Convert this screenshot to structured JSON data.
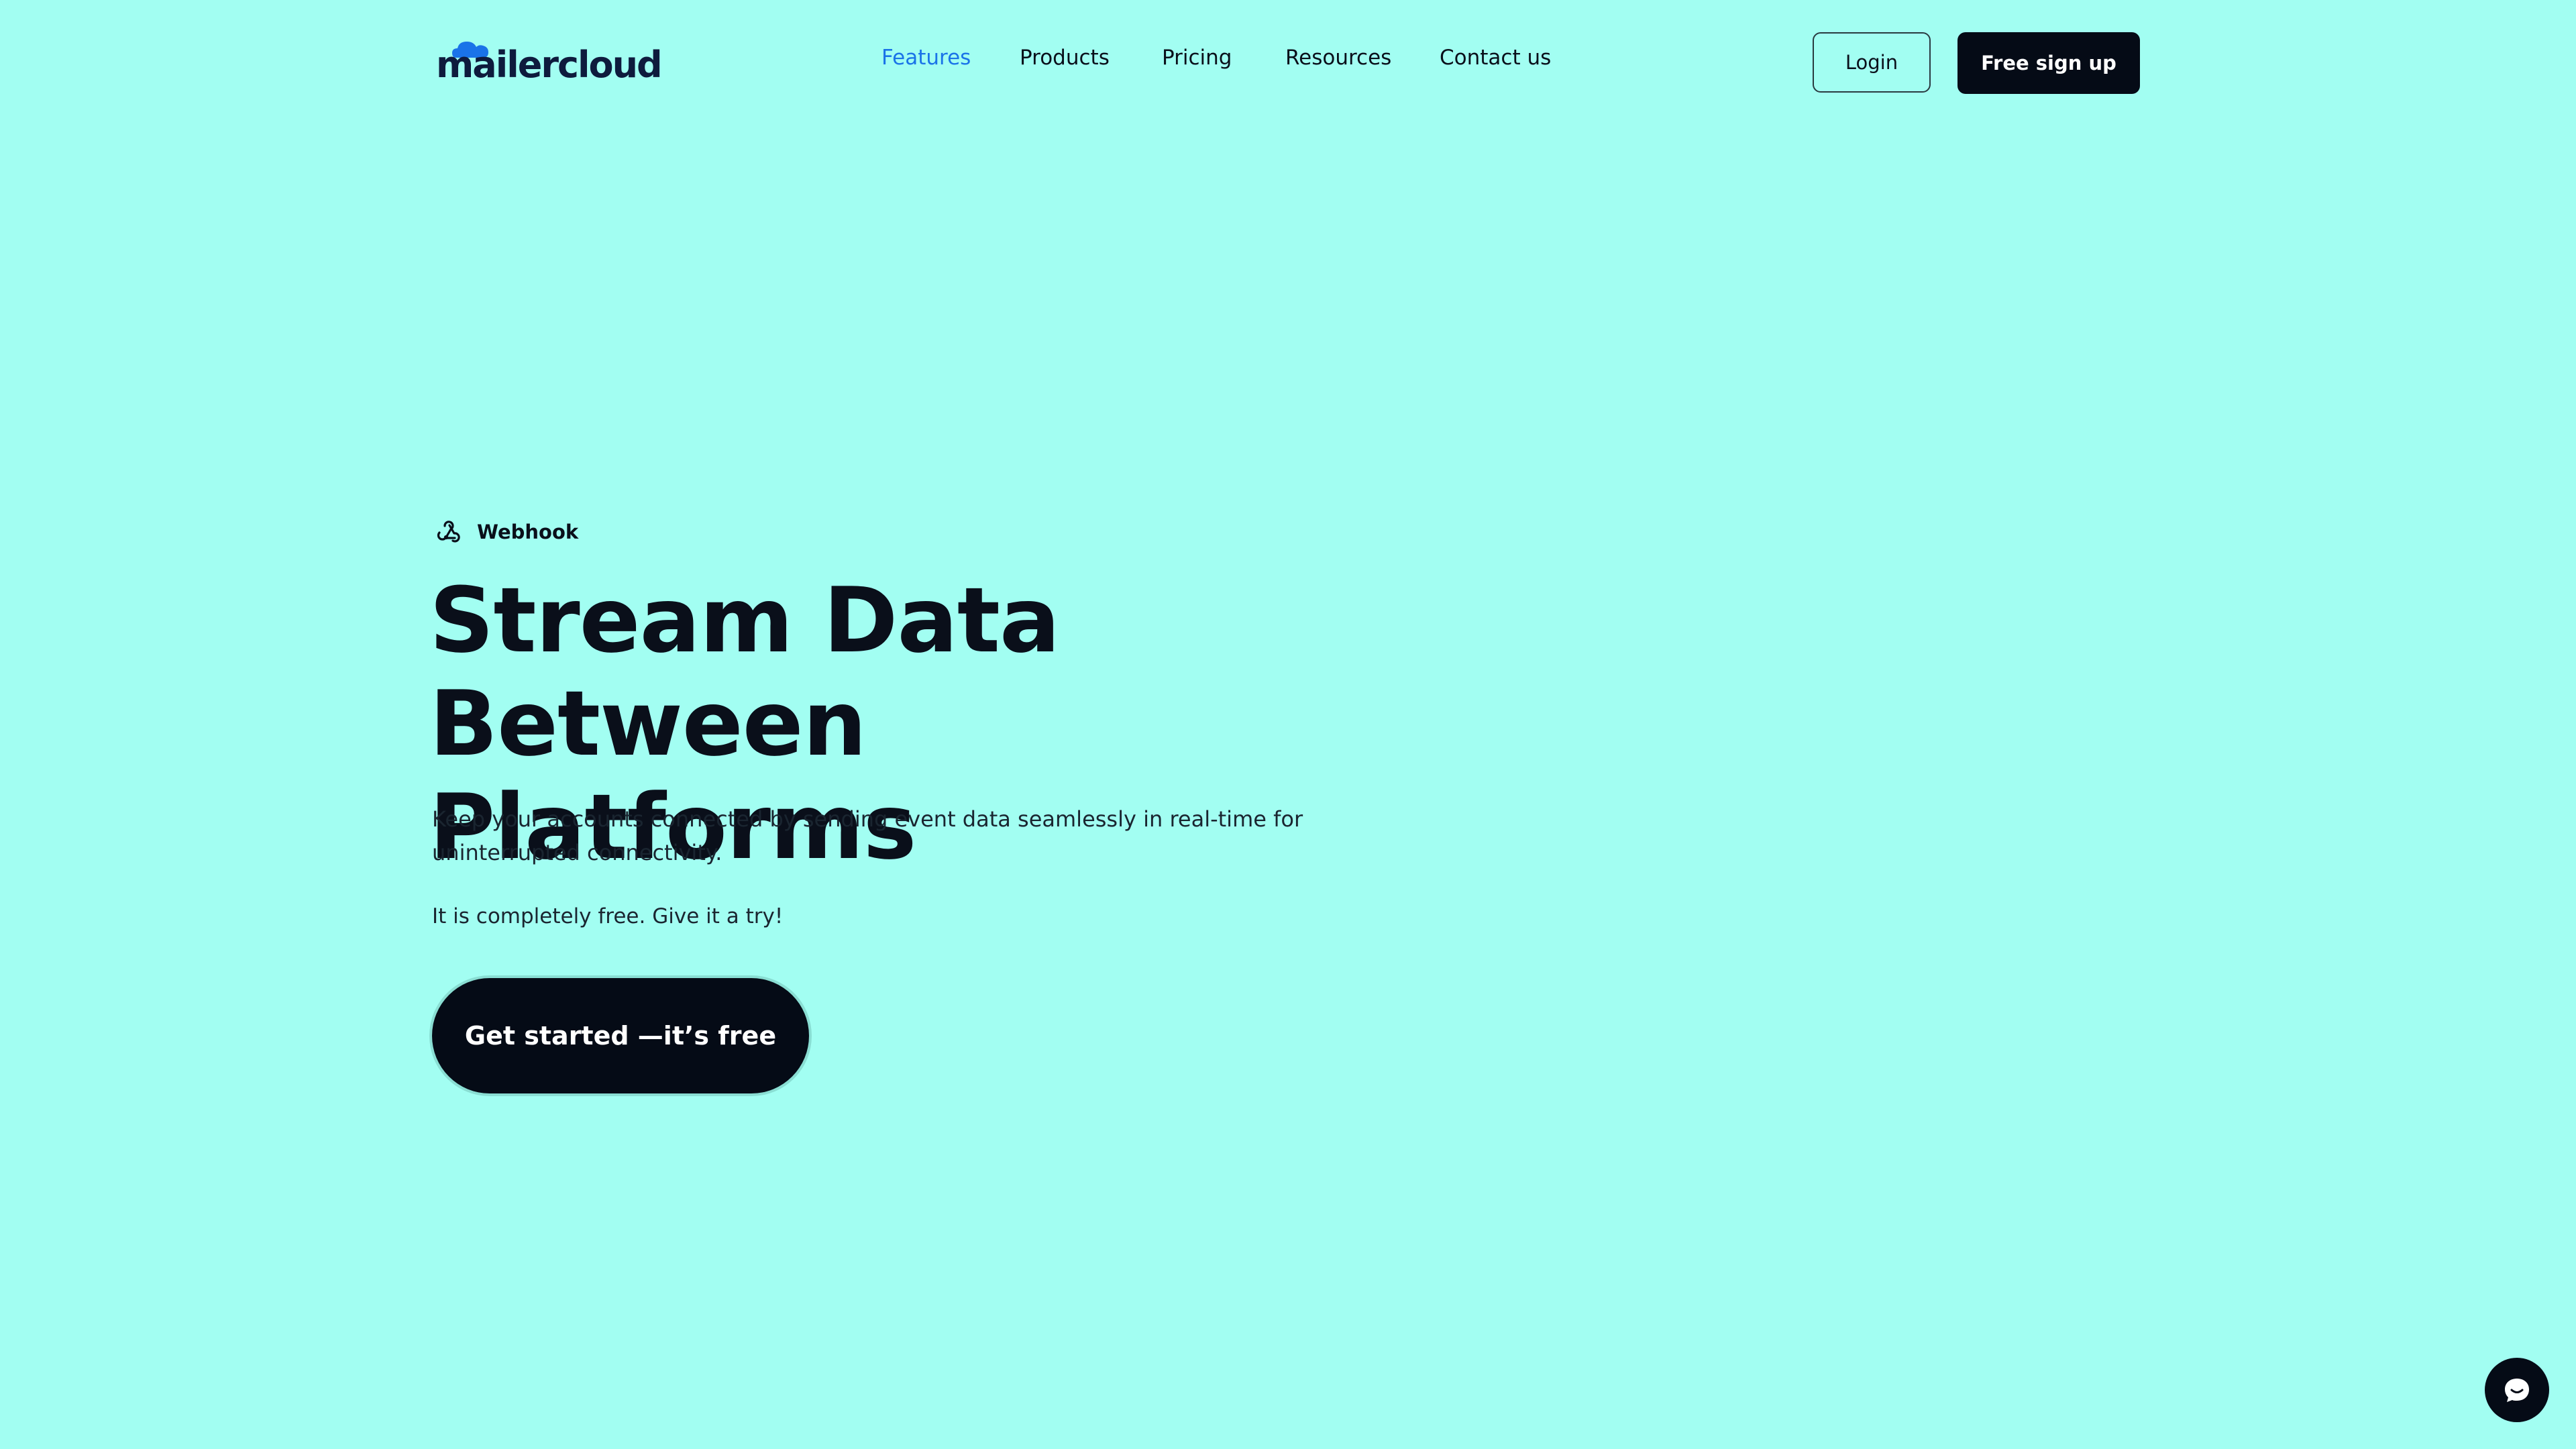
{
  "header": {
    "logo_text": "mailercloud",
    "nav": [
      {
        "label": "Features",
        "active": true
      },
      {
        "label": "Products",
        "active": false
      },
      {
        "label": "Pricing",
        "active": false
      },
      {
        "label": "Resources",
        "active": false
      },
      {
        "label": "Contact us",
        "active": false
      }
    ],
    "login_label": "Login",
    "signup_label": "Free sign up"
  },
  "hero": {
    "eyebrow_icon": "webhook-icon",
    "eyebrow_label": "Webhook",
    "headline_line1": "Stream Data Between",
    "headline_line2": "Platforms",
    "description": "Keep your accounts connected by sending event data seamlessly in real-time for uninterrupted connectivity.",
    "free_note": "It is completely free. Give it a try!",
    "cta_label": "Get started —it’s free"
  },
  "chat": {
    "icon": "chat-icon"
  },
  "colors": {
    "background": "#a2fef2",
    "dark": "#050b16",
    "accent": "#1a73e8",
    "logo_cloud": "#1a73e8"
  }
}
